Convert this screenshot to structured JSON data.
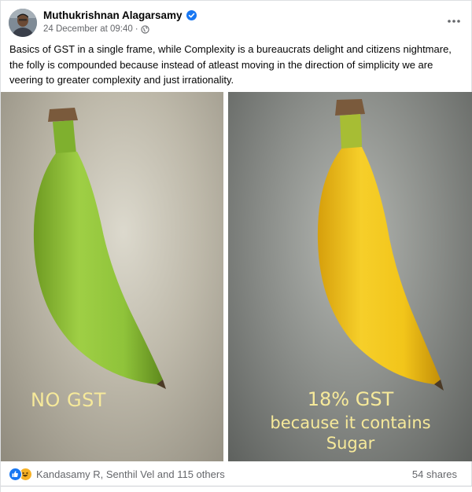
{
  "post": {
    "author": "Muthukrishnan Alagarsamy",
    "timestamp": "24 December at 09:40",
    "separator": "·",
    "text": "Basics of GST in a single frame, while Complexity is a bureaucrats delight and citizens nightmare, the folly is compounded because instead of atleast moving in the direction of simplicity we are veering to greater complexity and just irrationality.",
    "icons": {
      "verified": "verified-badge-icon",
      "audience": "globe-icon",
      "more": "more-options-icon"
    }
  },
  "image": {
    "left_caption": "NO GST",
    "right_caption_line1": "18% GST",
    "right_caption_line2": "because it contains",
    "right_caption_line3": "Sugar"
  },
  "footer": {
    "reactions_text": "Kandasamy R, Senthil Vel and 115 others",
    "shares_text": "54 shares",
    "reaction_icons": [
      "like-icon",
      "haha-icon"
    ]
  },
  "colors": {
    "brand_blue": "#1877f2",
    "text_secondary": "#65676b",
    "caption_yellow": "#f6e99a",
    "green_banana": "#8fc33a",
    "yellow_banana": "#f2c51a"
  }
}
